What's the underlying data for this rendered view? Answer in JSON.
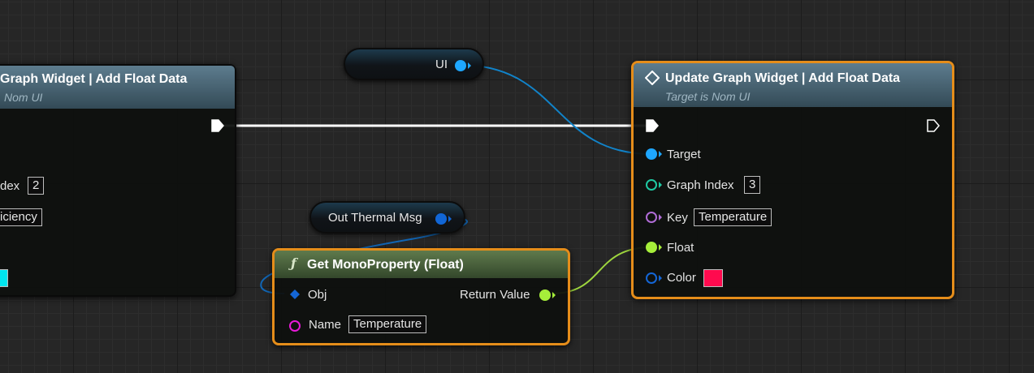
{
  "graph": {
    "left_node": {
      "title": "Graph Widget  |  Add Float Data",
      "subtitle": "Nom UI",
      "graph_index_label": "dex",
      "graph_index_value": "2",
      "key_value": "iciency",
      "color_value": "#00e5ee"
    },
    "right_node": {
      "title": "Update Graph Widget  |  Add Float Data",
      "subtitle": "Target is Nom UI",
      "pins": {
        "target": "Target",
        "graph_index": "Graph Index",
        "graph_index_value": "3",
        "key": "Key",
        "key_value": "Temperature",
        "float": "Float",
        "color": "Color",
        "color_value": "#ff0a4e"
      }
    },
    "ui_var": {
      "label": "UI"
    },
    "thermal_var": {
      "label": "Out Thermal Msg"
    },
    "get_property_node": {
      "title": "Get MonoProperty (Float)",
      "obj_label": "Obj",
      "return_label": "Return Value",
      "name_label": "Name",
      "name_value": "Temperature"
    },
    "colors": {
      "exec_wire": "#ffffff",
      "object_wire": "#1183c9",
      "float_wire": "#9ed63e",
      "object_pin": "#1ea7ff",
      "int_pin": "#1fc9a3",
      "name_pin": "#b06cd6",
      "float_pin": "#a6ee3a",
      "struct_pin": "#1466d6",
      "name_pin_magenta": "#e81ad8",
      "selection": "#e58d1a"
    }
  }
}
